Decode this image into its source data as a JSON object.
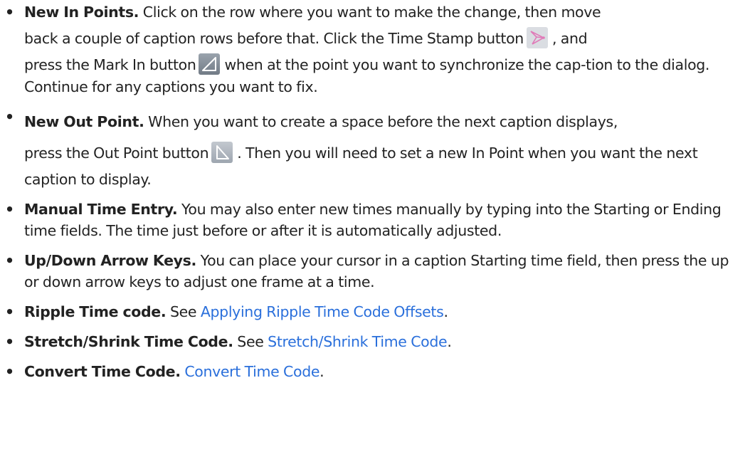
{
  "items": [
    {
      "term": "New In Points.",
      "segments": [
        " Click on the row where you want to make the change, then move",
        "back a couple of caption rows before that. Click the Time Stamp button",
        ", and",
        "press the Mark In button",
        "when at the point you want to synchronize the cap-tion to the dialog. Continue for any captions you want to fix."
      ]
    },
    {
      "term": "New Out Point.",
      "segments": [
        " When you want to create a space before the next caption displays,",
        "press the Out Point button",
        ". Then you will need to set a new In Point when you want the next caption to display."
      ]
    },
    {
      "term": "Manual Time Entry.",
      "text": " You may also enter new times manually by typing into the Starting or Ending time fields. The time just before or after it is automatically adjusted."
    },
    {
      "term": "Up/Down Arrow Keys.",
      "text": " You can place your cursor in a caption Starting time field, then press the up or down arrow keys to adjust one frame at a time."
    },
    {
      "term": "Ripple Time code.",
      "text": " See ",
      "link": "Applying Ripple Time Code Offsets",
      "after": "."
    },
    {
      "term": "Stretch/Shrink Time Code.",
      "text": " See ",
      "link": "Stretch/Shrink Time Code",
      "after": "."
    },
    {
      "term": "Convert Time Code.",
      "text": " ",
      "link": "Convert Time Code",
      "after": "."
    }
  ],
  "icons": {
    "time_stamp": "time-stamp-icon",
    "mark_in": "mark-in-icon",
    "out_point": "out-point-icon"
  },
  "colors": {
    "text": "#222222",
    "link": "#2a6fdb"
  }
}
